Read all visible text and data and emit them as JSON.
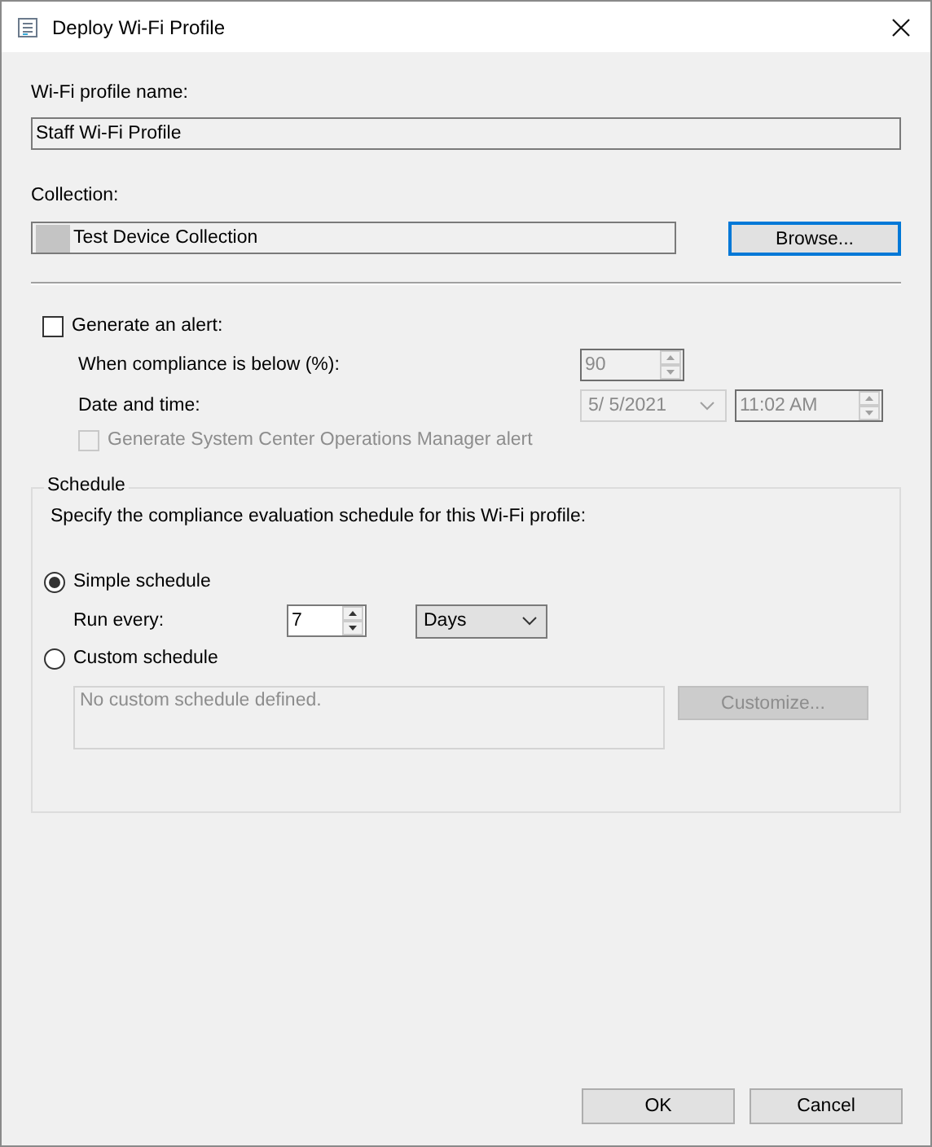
{
  "window": {
    "title": "Deploy Wi-Fi Profile"
  },
  "profile_name": {
    "label": "Wi-Fi profile name:",
    "value": "Staff Wi-Fi Profile"
  },
  "collection": {
    "label": "Collection:",
    "value": "Test Device Collection",
    "button": "Browse..."
  },
  "alert": {
    "label": "Generate an alert:",
    "checked": false,
    "compliance": {
      "label": "When compliance is below (%):",
      "value": "90"
    },
    "datetime": {
      "label": "Date and time:",
      "date": "5/  5/2021",
      "time": "11:02 AM"
    },
    "scom": {
      "label": "Generate System Center Operations Manager alert",
      "checked": false
    }
  },
  "schedule": {
    "title": "Schedule",
    "description": "Specify the compliance evaluation schedule for this Wi-Fi profile:",
    "options": [
      {
        "label": "Simple schedule",
        "selected": true
      },
      {
        "label": "Custom schedule",
        "selected": false
      }
    ],
    "run_every": {
      "label": "Run every:",
      "value": "7",
      "unit": "Days"
    },
    "custom_text": "No custom schedule defined.",
    "customize_button": "Customize..."
  },
  "buttons": [
    "OK",
    "Cancel"
  ]
}
